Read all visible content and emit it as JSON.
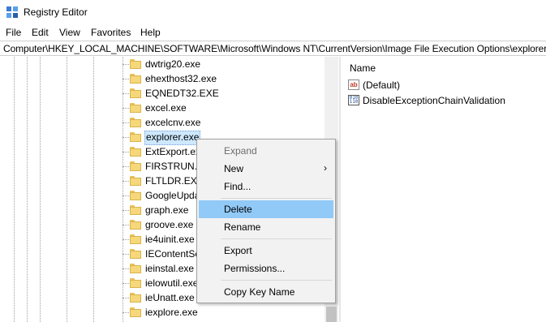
{
  "window": {
    "title": "Registry Editor"
  },
  "menu": [
    "File",
    "Edit",
    "View",
    "Favorites",
    "Help"
  ],
  "address": "Computer\\HKEY_LOCAL_MACHINE\\SOFTWARE\\Microsoft\\Windows NT\\CurrentVersion\\Image File Execution Options\\explorer.exe",
  "tree": {
    "items": [
      "dwtrig20.exe",
      "ehexthost32.exe",
      "EQNEDT32.EXE",
      "excel.exe",
      "excelcnv.exe",
      "explorer.exe",
      "ExtExport.exe",
      "FIRSTRUN.EXE",
      "FLTLDR.EXE",
      "GoogleUpdate.exe",
      "graph.exe",
      "groove.exe",
      "ie4uinit.exe",
      "IEContentService.exe",
      "ieinstal.exe",
      "ielowutil.exe",
      "ieUnatt.exe",
      "iexplore.exe"
    ],
    "selected": "explorer.exe"
  },
  "values": {
    "column_name": "Name",
    "rows": [
      {
        "name": "(Default)",
        "icon": "string-value-icon"
      },
      {
        "name": "DisableExceptionChainValidation",
        "icon": "binary-value-icon"
      }
    ]
  },
  "context_menu": {
    "items": [
      "Expand",
      "New",
      "Find...",
      "Delete",
      "Rename",
      "Export",
      "Permissions...",
      "Copy Key Name"
    ],
    "disabled": "Expand",
    "highlighted": "Delete"
  }
}
